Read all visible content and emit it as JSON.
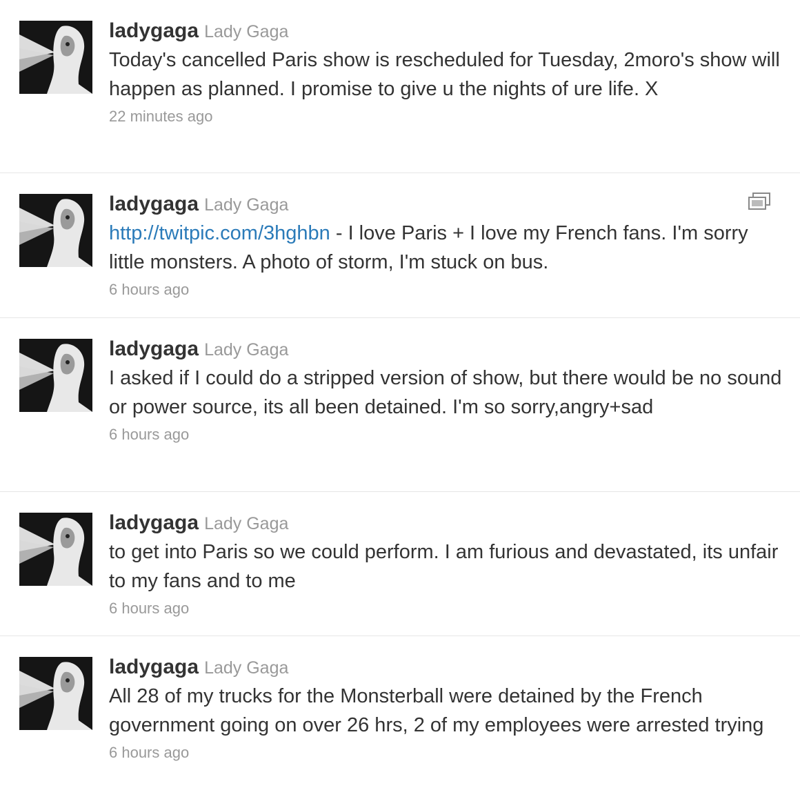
{
  "tweets": [
    {
      "screen_name": "ladygaga",
      "full_name": "Lady Gaga",
      "link": "",
      "text": "Today's cancelled Paris show is rescheduled for Tuesday, 2moro's show will happen as planned. I promise to give u the nights of ure life. X",
      "time": "22 minutes ago",
      "has_media": false
    },
    {
      "screen_name": "ladygaga",
      "full_name": "Lady Gaga",
      "link": "http://twitpic.com/3hghbn",
      "text": " - I love Paris + I love my French fans. I'm sorry little monsters. A photo of storm, I'm stuck on bus.",
      "time": "6 hours ago",
      "has_media": true,
      "media_icon": "gallery-icon"
    },
    {
      "screen_name": "ladygaga",
      "full_name": "Lady Gaga",
      "link": "",
      "text": "I asked if I could do a stripped version of show, but there would be no sound or power source, its all been detained. I'm so sorry,angry+sad",
      "time": "6 hours ago",
      "has_media": false
    },
    {
      "screen_name": "ladygaga",
      "full_name": "Lady Gaga",
      "link": "",
      "text": "to get into Paris so we could perform. I am furious and devastated, its unfair to my fans and to me",
      "time": "6 hours ago",
      "has_media": false
    },
    {
      "screen_name": "ladygaga",
      "full_name": "Lady Gaga",
      "link": "",
      "text": "All 28 of my trucks for the Monsterball were detained by the French government going on over 26 hrs, 2 of my employees were arrested trying",
      "time": "6 hours ago",
      "has_media": false
    }
  ],
  "colors": {
    "link": "#2b7bb9",
    "muted": "#999999",
    "text": "#333333",
    "divider": "#e6e6e6"
  }
}
